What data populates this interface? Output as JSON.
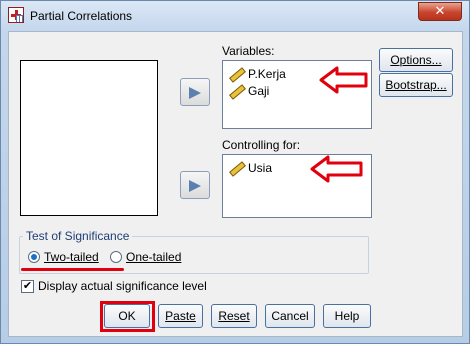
{
  "window": {
    "title": "Partial Correlations",
    "close_glyph": "✕"
  },
  "source_list": {
    "items": []
  },
  "variables": {
    "label": "Variables:",
    "items": [
      "P.Kerja",
      "Gaji"
    ]
  },
  "controlling": {
    "label": "Controlling for:",
    "items": [
      "Usia"
    ]
  },
  "side_buttons": {
    "options": "Options...",
    "bootstrap": "Bootstrap..."
  },
  "significance": {
    "group_title": "Test of Significance",
    "two_tailed": "Two-tailed",
    "one_tailed": "One-tailed",
    "selected": "two-tailed"
  },
  "display_significance": {
    "label": "Display actual significance level",
    "checked": true,
    "glyph": "✔"
  },
  "footer_buttons": {
    "ok": "OK",
    "paste": "Paste",
    "reset": "Reset",
    "cancel": "Cancel",
    "help": "Help"
  },
  "annotations": {
    "color": "#e0000e"
  },
  "icons": {
    "app": "partial-correlations-app-icon",
    "variable": "scale-ruler-icon",
    "move": "right-arrow-icon"
  }
}
